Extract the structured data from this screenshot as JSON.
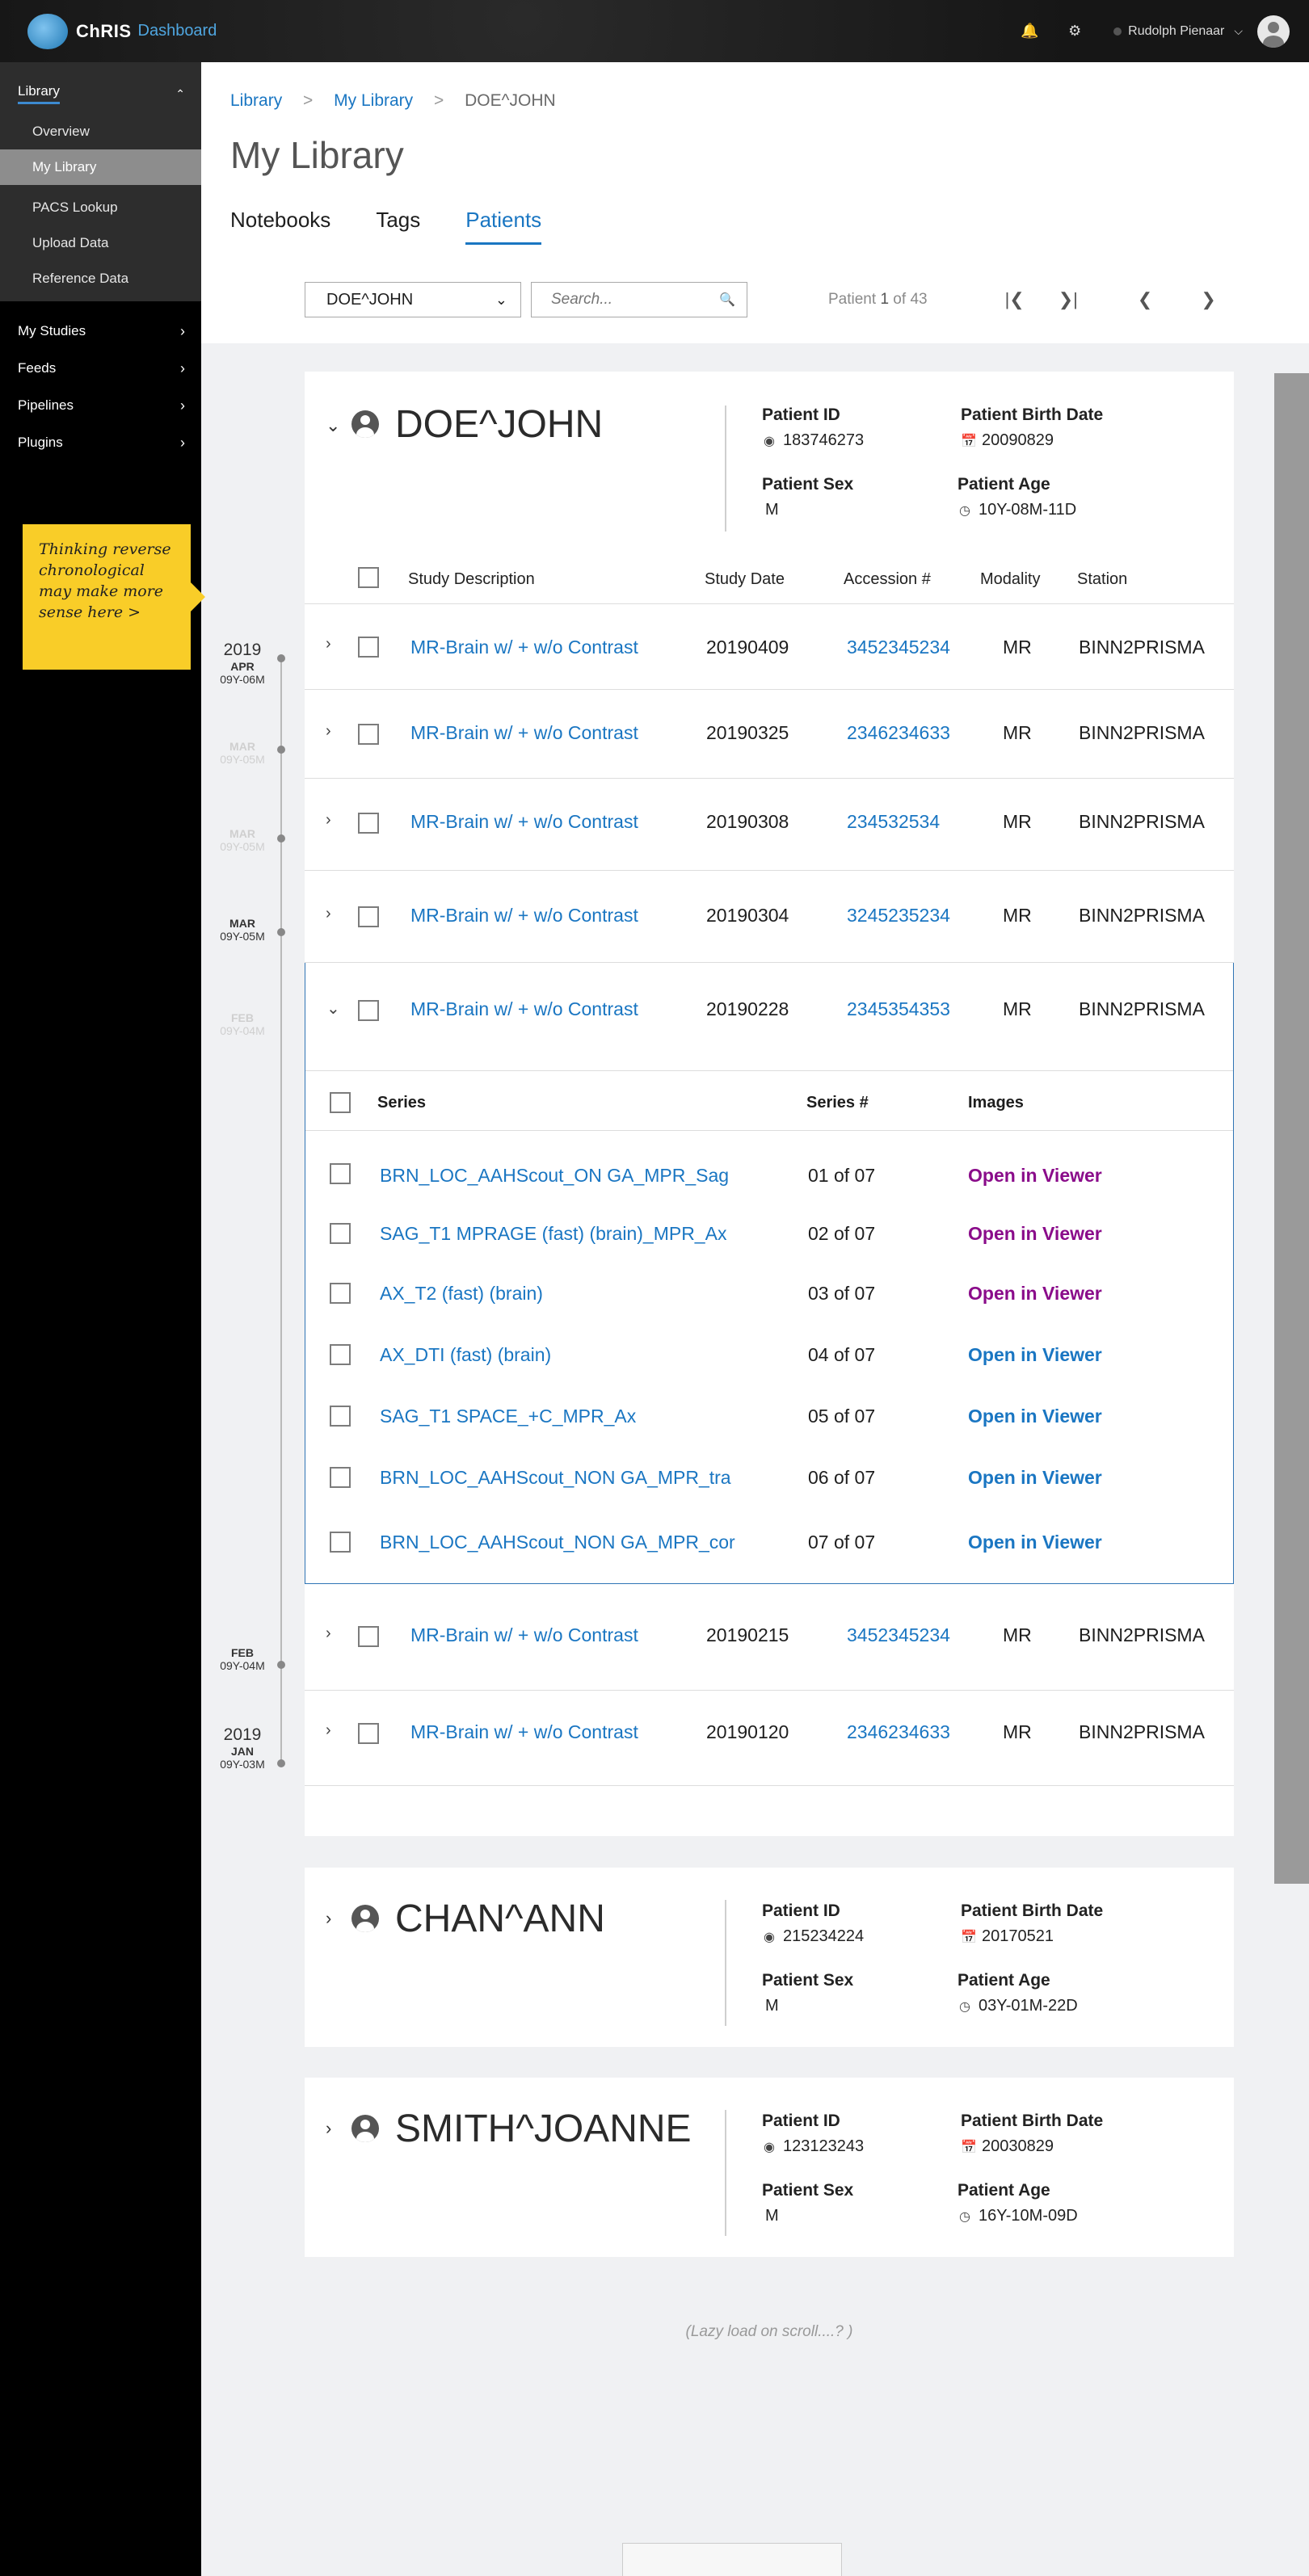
{
  "header": {
    "brand": "ChRIS",
    "brand_sub": "Dashboard",
    "user_name": "Rudolph Pienaar"
  },
  "sidebar": {
    "library_label": "Library",
    "library_items": [
      {
        "label": "Overview"
      },
      {
        "label": "My Library",
        "active": true
      },
      {
        "label": "PACS Lookup"
      },
      {
        "label": "Upload Data"
      },
      {
        "label": "Reference Data"
      }
    ],
    "nav_items": [
      {
        "label": "My Studies"
      },
      {
        "label": "Feeds"
      },
      {
        "label": "Pipelines"
      },
      {
        "label": "Plugins"
      }
    ],
    "note": "Thinking reverse chronological may make more sense here >"
  },
  "breadcrumb": [
    "Library",
    "My Library",
    "DOE^JOHN"
  ],
  "page_title": "My Library",
  "tabs": [
    "Notebooks",
    "Tags",
    "Patients"
  ],
  "active_tab": "Patients",
  "toolbar": {
    "patient_select": "DOE^JOHN",
    "search_placeholder": "Search...",
    "pager_prefix": "Patient",
    "pager_current": "1",
    "pager_of": "of",
    "pager_total": "43"
  },
  "labels": {
    "patient_id": "Patient ID",
    "birth_date": "Patient Birth Date",
    "sex": "Patient Sex",
    "age": "Patient Age",
    "study_description": "Study Description",
    "study_date": "Study Date",
    "accession": "Accession #",
    "modality": "Modality",
    "station": "Station",
    "series": "Series",
    "series_num": "Series #",
    "images": "Images"
  },
  "patients": [
    {
      "name": "DOE^JOHN",
      "id": "183746273",
      "birth_date": "20090829",
      "sex": "M",
      "age": "10Y-08M-11D"
    },
    {
      "name": "CHAN^ANN",
      "id": "215234224",
      "birth_date": "20170521",
      "sex": "M",
      "age": "03Y-01M-22D"
    },
    {
      "name": "SMITH^JOANNE",
      "id": "123123243",
      "birth_date": "20030829",
      "sex": "M",
      "age": "16Y-10M-09D"
    }
  ],
  "studies": [
    {
      "description": "MR-Brain w/ + w/o Contrast",
      "date": "20190409",
      "accession": "3452345234",
      "modality": "MR",
      "station": "BINN2PRISMA"
    },
    {
      "description": "MR-Brain w/ + w/o Contrast",
      "date": "20190325",
      "accession": "2346234633",
      "modality": "MR",
      "station": "BINN2PRISMA"
    },
    {
      "description": "MR-Brain w/ + w/o Contrast",
      "date": "20190308",
      "accession": "234532534",
      "modality": "MR",
      "station": "BINN2PRISMA"
    },
    {
      "description": "MR-Brain w/ + w/o Contrast",
      "date": "20190304",
      "accession": "3245235234",
      "modality": "MR",
      "station": "BINN2PRISMA"
    },
    {
      "description": "MR-Brain w/ + w/o Contrast",
      "date": "20190228",
      "accession": "2345354353",
      "modality": "MR",
      "station": "BINN2PRISMA"
    },
    {
      "description": "MR-Brain w/ + w/o Contrast",
      "date": "20190215",
      "accession": "3452345234",
      "modality": "MR",
      "station": "BINN2PRISMA"
    },
    {
      "description": "MR-Brain w/ + w/o Contrast",
      "date": "20190120",
      "accession": "2346234633",
      "modality": "MR",
      "station": "BINN2PRISMA"
    }
  ],
  "series": [
    {
      "name": "BRN_LOC_AAHScout_ON GA_MPR_Sag",
      "number": "01 of 07",
      "viewer": "Open in Viewer",
      "visited": true
    },
    {
      "name": "SAG_T1 MPRAGE (fast) (brain)_MPR_Ax",
      "number": "02 of 07",
      "viewer": "Open in Viewer",
      "visited": true
    },
    {
      "name": "AX_T2 (fast) (brain)",
      "number": "03 of 07",
      "viewer": "Open in Viewer",
      "visited": true
    },
    {
      "name": "AX_DTI (fast) (brain)",
      "number": "04 of 07",
      "viewer": "Open in Viewer",
      "visited": false
    },
    {
      "name": "SAG_T1 SPACE_+C_MPR_Ax",
      "number": "05 of 07",
      "viewer": "Open in Viewer",
      "visited": false
    },
    {
      "name": "BRN_LOC_AAHScout_NON GA_MPR_tra",
      "number": "06 of 07",
      "viewer": "Open in Viewer",
      "visited": false
    },
    {
      "name": "BRN_LOC_AAHScout_NON GA_MPR_cor",
      "number": "07 of 07",
      "viewer": "Open in Viewer",
      "visited": false
    }
  ],
  "timeline": [
    {
      "year": "2019",
      "month": "APR",
      "age": "09Y-06M",
      "faint": false
    },
    {
      "year": "",
      "month": "MAR",
      "age": "09Y-05M",
      "faint": true
    },
    {
      "year": "",
      "month": "MAR",
      "age": "09Y-05M",
      "faint": true
    },
    {
      "year": "",
      "month": "MAR",
      "age": "09Y-05M",
      "faint": false
    },
    {
      "year": "",
      "month": "FEB",
      "age": "09Y-04M",
      "faint": true
    },
    {
      "year": "",
      "month": "FEB",
      "age": "09Y-04M",
      "faint": false
    },
    {
      "year": "2019",
      "month": "JAN",
      "age": "09Y-03M",
      "faint": false
    }
  ],
  "lazy_load_text": "(Lazy load on scroll....? )",
  "colors": {
    "accent": "#1a76c2",
    "visited": "#8a0c8a",
    "note": "#f9cd28",
    "sidebar_active": "#8d8d8d"
  }
}
